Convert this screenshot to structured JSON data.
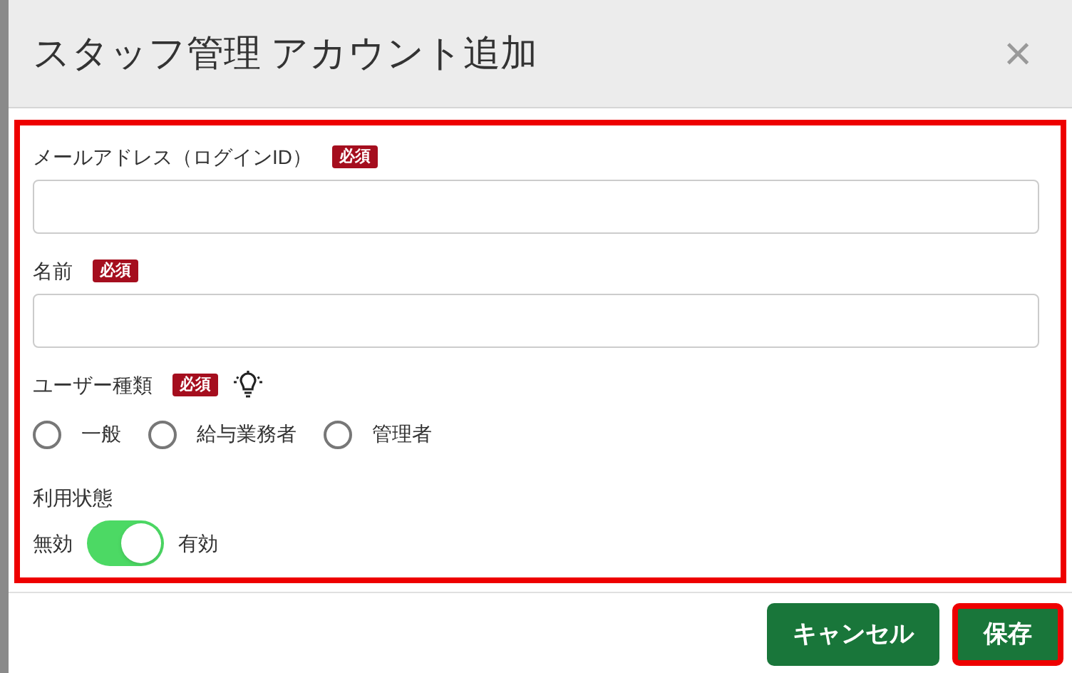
{
  "dialog": {
    "title": "スタッフ管理 アカウント追加",
    "close": "×"
  },
  "fields": [
    {
      "kind": "text",
      "label": "メールアドレス（ログインID）",
      "required_badge": "必須"
    },
    {
      "kind": "text",
      "label": "名前",
      "required_badge": "必須"
    },
    {
      "kind": "radio",
      "label": "ユーザー種類",
      "required_badge": "必須",
      "hint_icon": true,
      "options": [
        {
          "label": "一般",
          "selected": false
        },
        {
          "label": "給与業務者",
          "selected": false
        },
        {
          "label": "管理者",
          "selected": false
        }
      ]
    },
    {
      "kind": "toggle",
      "label": "利用状態",
      "off_label": "無効",
      "on_label": "有効",
      "on": true
    }
  ],
  "buttons": [
    {
      "label": "キャンセル",
      "highlighted": false
    },
    {
      "label": "保存",
      "highlighted": true
    }
  ]
}
